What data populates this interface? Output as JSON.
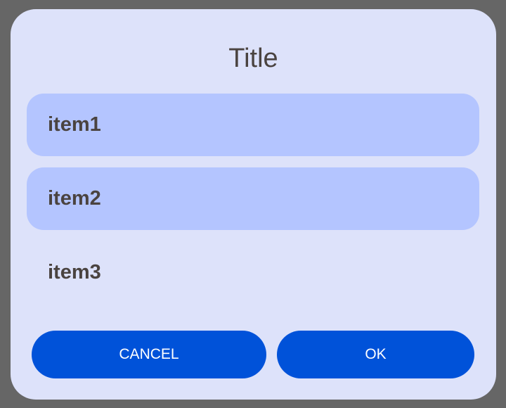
{
  "dialog": {
    "title": "Title",
    "items": [
      {
        "label": "item1",
        "selected": true
      },
      {
        "label": "item2",
        "selected": true
      },
      {
        "label": "item3",
        "selected": false
      }
    ],
    "buttons": {
      "cancel_label": "CANCEL",
      "ok_label": "OK"
    }
  },
  "colors": {
    "backdrop": "#666666",
    "dialog_background": "#dde2fa",
    "selected_item_background": "#b4c5ff",
    "button_background": "#0052d9",
    "text": "#4a4340"
  }
}
